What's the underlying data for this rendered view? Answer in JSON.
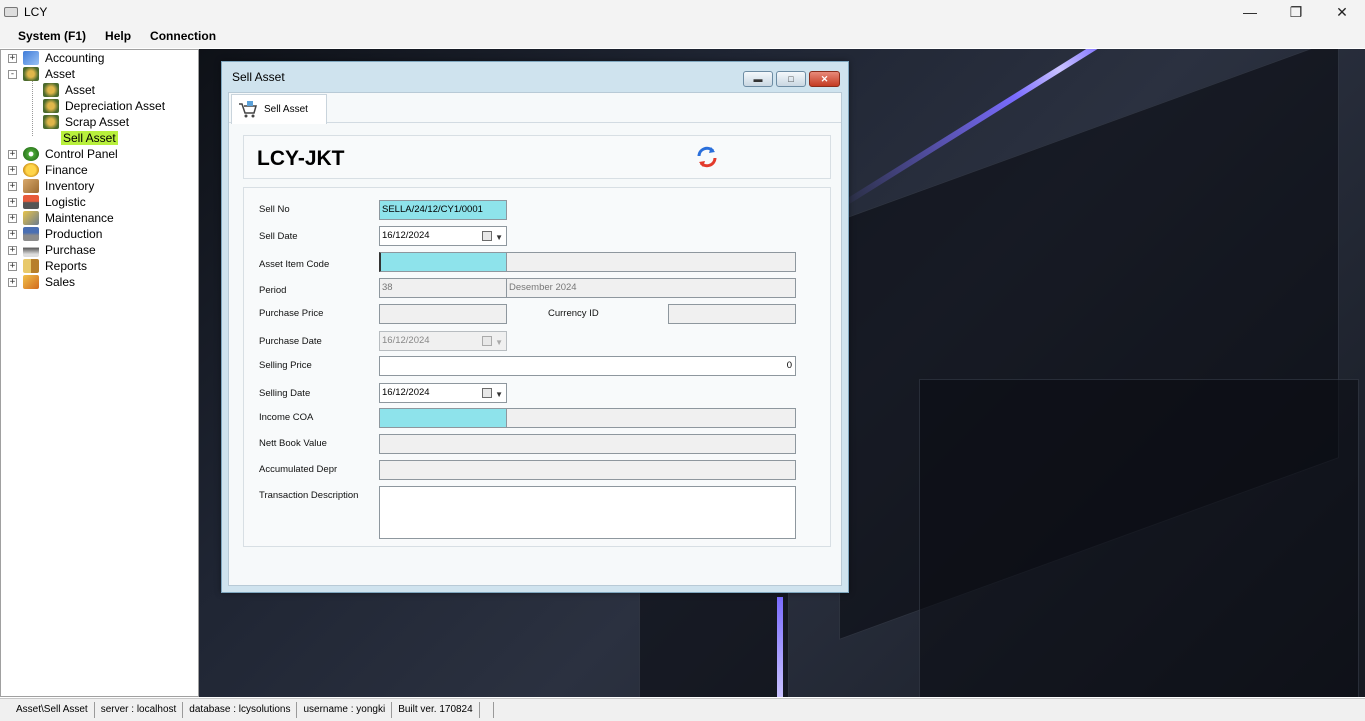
{
  "window": {
    "title": "LCY"
  },
  "menu": [
    "System (F1)",
    "Help",
    "Connection"
  ],
  "sidebar": {
    "items": [
      {
        "label": "Accounting",
        "icon": "accounting-icon",
        "expander": "+"
      },
      {
        "label": "Asset",
        "icon": "asset-icon",
        "expander": "-"
      },
      {
        "label": "Asset",
        "icon": "asset-sub-icon"
      },
      {
        "label": "Depreciation Asset",
        "icon": "depreciation-icon"
      },
      {
        "label": "Scrap Asset",
        "icon": "scrap-icon"
      },
      {
        "label": "Sell Asset",
        "icon": "sell-icon",
        "selected": true
      },
      {
        "label": "Control Panel",
        "icon": "gear-icon",
        "expander": "+"
      },
      {
        "label": "Finance",
        "icon": "finance-icon",
        "expander": "+"
      },
      {
        "label": "Inventory",
        "icon": "inventory-icon",
        "expander": "+"
      },
      {
        "label": "Logistic",
        "icon": "logistic-icon",
        "expander": "+"
      },
      {
        "label": "Maintenance",
        "icon": "maintenance-icon",
        "expander": "+"
      },
      {
        "label": "Production",
        "icon": "production-icon",
        "expander": "+"
      },
      {
        "label": "Purchase",
        "icon": "purchase-icon",
        "expander": "+"
      },
      {
        "label": "Reports",
        "icon": "reports-icon",
        "expander": "+"
      },
      {
        "label": "Sales",
        "icon": "sales-icon",
        "expander": "+"
      }
    ]
  },
  "dialog": {
    "title": "Sell Asset",
    "tab_label": "Sell Asset",
    "company": "LCY-JKT",
    "fields": {
      "sell_no_label": "Sell No",
      "sell_no_value": "SELLA/24/12/CY1/0001",
      "sell_date_label": "Sell Date",
      "sell_date_value": "16/12/2024",
      "asset_item_code_label": "Asset Item Code",
      "asset_item_code_value": "",
      "period_label": "Period",
      "period_value": "38",
      "period_name": "Desember 2024",
      "purchase_price_label": "Purchase Price",
      "purchase_price_value": "",
      "currency_id_label": "Currency ID",
      "currency_id_value": "",
      "purchase_date_label": "Purchase Date",
      "purchase_date_value": "16/12/2024",
      "selling_price_label": "Selling Price",
      "selling_price_value": "0",
      "selling_date_label": "Selling Date",
      "selling_date_value": "16/12/2024",
      "income_coa_label": "Income COA",
      "income_coa_value": "",
      "nett_book_value_label": "Nett Book Value",
      "nett_book_value_value": "",
      "accumulated_depr_label": "Accumulated Depr",
      "accumulated_depr_value": "",
      "transaction_description_label": "Transaction Description",
      "transaction_description_value": ""
    }
  },
  "statusbar": [
    "Asset\\Sell Asset",
    "server : localhost",
    "database : lcysolutions",
    "username : yongki",
    "Built ver. 170824"
  ],
  "colors": {
    "selected_highlight": "#b8f03c",
    "input_cyan": "#8ee3eb",
    "dialog_frame": "#cfe3ee"
  }
}
